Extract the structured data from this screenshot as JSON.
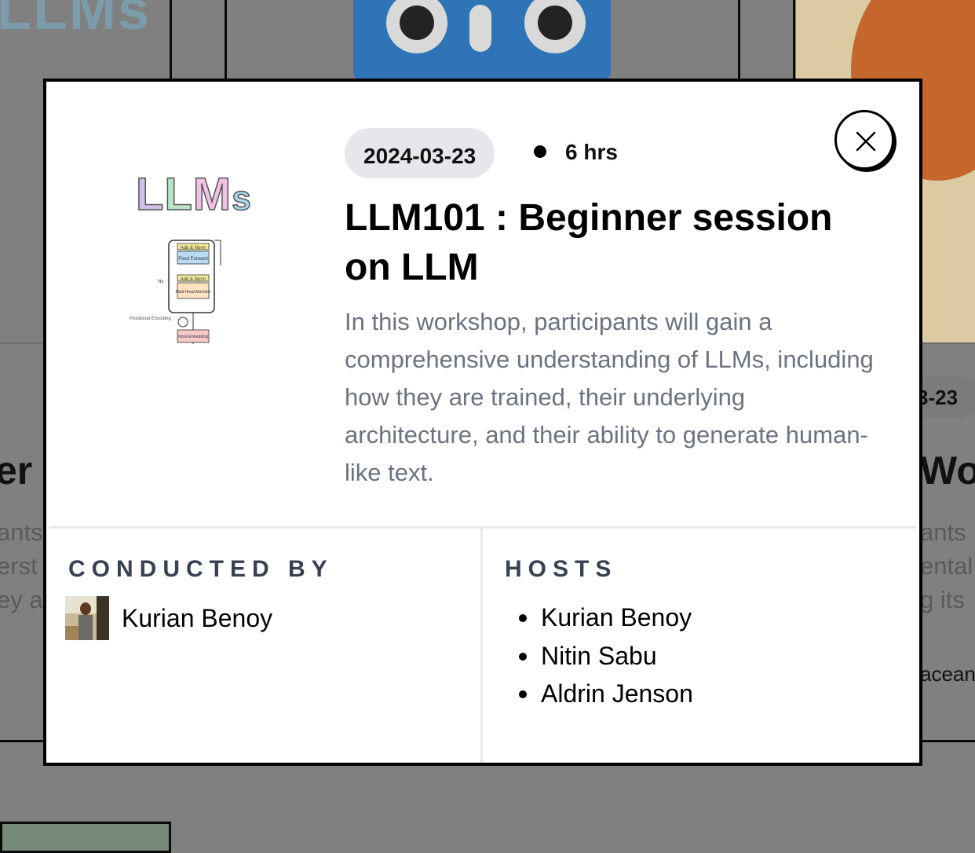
{
  "background": {
    "logo_fragment": "LLMs",
    "right_date_fragment": "3-23",
    "left_title_fragment": "er s",
    "right_title_fragment": "Wo",
    "left_desc_lines": [
      "ants",
      "erst",
      "ey a"
    ],
    "right_desc_lines": [
      "ants",
      "ental",
      "g its"
    ],
    "right_org_fragment": "acean"
  },
  "modal": {
    "thumbnail": {
      "title_letters": [
        "L",
        "L",
        "M",
        "s"
      ],
      "diagram_labels": [
        "Add & Norm",
        "Feed Forward",
        "Nx",
        "Add & Norm",
        "Multi-Head Attention",
        "Positional Encoding",
        "Input Embedding"
      ]
    },
    "date": "2024-03-23",
    "duration": "6 hrs",
    "title": "LLM101 : Beginner session on LLM",
    "description": "In this workshop, participants will gain a comprehensive understanding of LLMs, including how they are trained, their underlying architecture, and their ability to generate human-like text.",
    "close_icon": "close-icon",
    "conducted_by": {
      "label": "CONDUCTED BY",
      "name": "Kurian Benoy"
    },
    "hosts": {
      "label": "HOSTS",
      "items": [
        "Kurian Benoy",
        "Nitin Sabu",
        "Aldrin Jenson"
      ]
    }
  },
  "colors": {
    "overlay": "#808080",
    "border": "#000000",
    "pill": "#e5e7eb",
    "description": "#6b7280"
  }
}
